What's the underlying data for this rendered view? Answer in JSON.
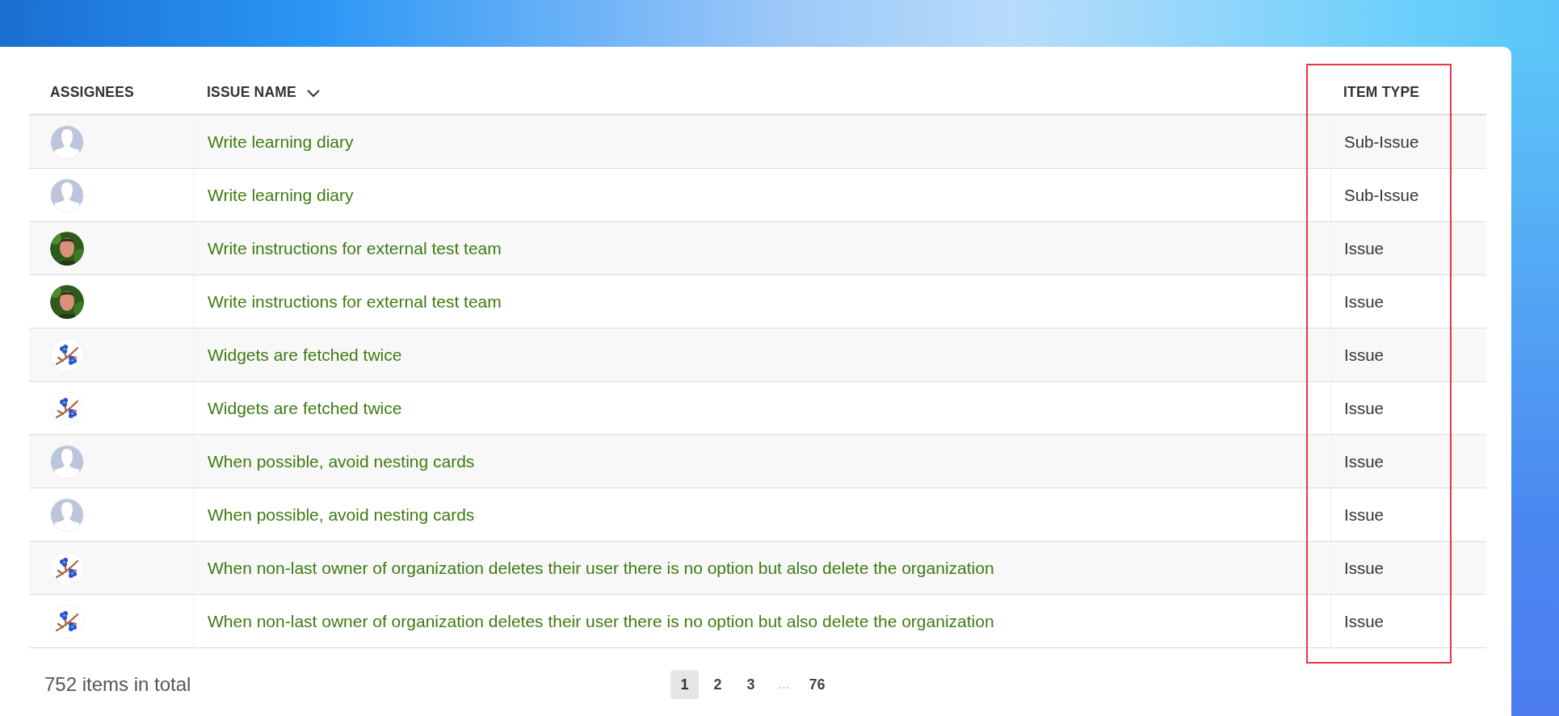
{
  "table": {
    "columns": [
      {
        "label": "ASSIGNEES",
        "sortable": false,
        "highlighted": false
      },
      {
        "label": "ISSUE NAME",
        "sortable": true,
        "highlighted": false
      },
      {
        "label": "ITEM TYPE",
        "sortable": false,
        "highlighted": true
      }
    ],
    "rows": [
      {
        "avatar": {
          "kind": "placeholder"
        },
        "issue_name": "Write learning diary",
        "item_type": "Sub-Issue"
      },
      {
        "avatar": {
          "kind": "placeholder"
        },
        "issue_name": "Write learning diary",
        "item_type": "Sub-Issue"
      },
      {
        "issue_name": "Write instructions for external test team",
        "item_type": "Issue"
      },
      {
        "issue_name": "Write instructions for external test team",
        "item_type": "Issue"
      },
      {
        "avatar": {
          "kind": "flower"
        },
        "issue_name": "Widgets are fetched twice",
        "item_type": "Issue"
      },
      {
        "avatar": {
          "kind": "flower"
        },
        "issue_name": "Widgets are fetched twice",
        "item_type": "Issue"
      },
      {
        "avatar": {
          "kind": "placeholder"
        },
        "issue_name": "When possible, avoid nesting cards",
        "item_type": "Issue"
      },
      {
        "avatar": {
          "kind": "placeholder"
        },
        "issue_name": "When possible, avoid nesting cards",
        "item_type": "Issue"
      },
      {
        "avatar": {
          "kind": "flower"
        },
        "issue_name": "When non-last owner of organization deletes their user there is no option but also delete the organization",
        "item_type": "Issue"
      },
      {
        "avatar": {
          "kind": "flower"
        },
        "issue_name": "When non-last owner of organization deletes their user there is no option but also delete the organization",
        "item_type": "Issue"
      }
    ]
  },
  "footer": {
    "total": "752 items in total",
    "pages": [
      {
        "label": "1",
        "kind": "page",
        "selected": true
      },
      {
        "label": "2",
        "kind": "page",
        "selected": false
      },
      {
        "label": "3",
        "kind": "page",
        "selected": false
      },
      {
        "label": "…",
        "kind": "ellipsis",
        "selected": false
      },
      {
        "label": "76",
        "kind": "page",
        "selected": false
      }
    ]
  }
}
